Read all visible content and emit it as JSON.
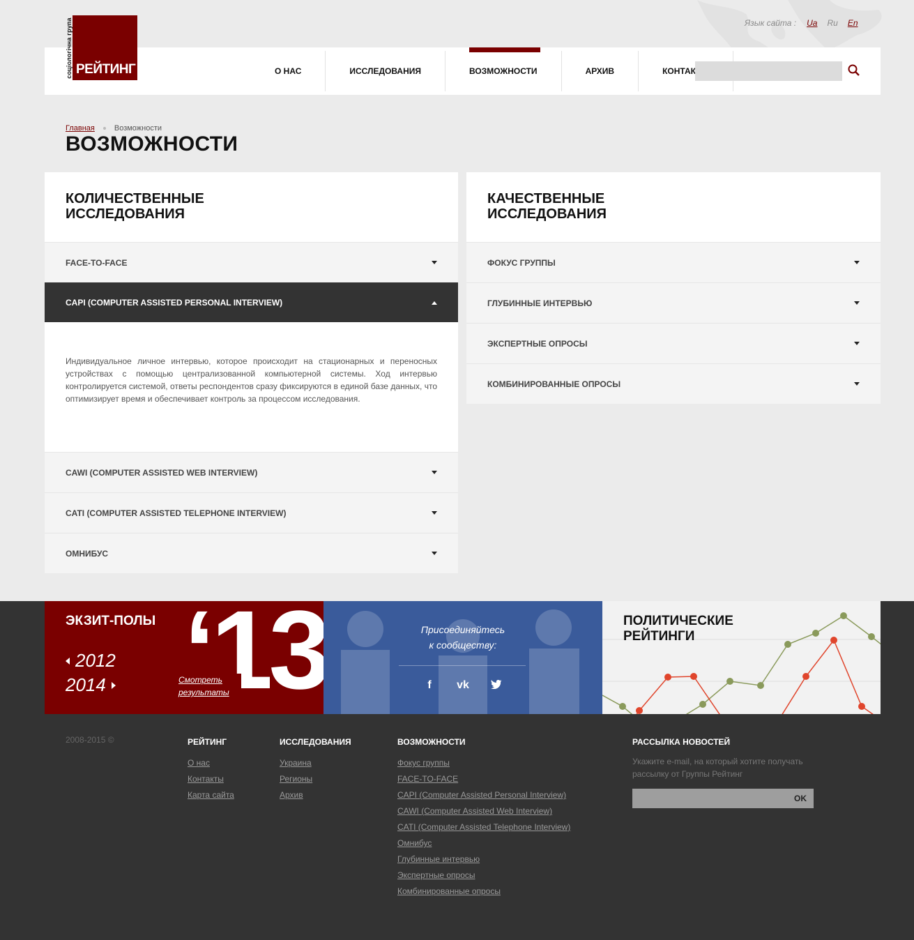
{
  "language": {
    "label": "Язык сайта :",
    "options": [
      "Ua",
      "Ru",
      "En"
    ]
  },
  "logo": {
    "vertical_text": "соціологічна група",
    "name": "РЕЙТИНГ"
  },
  "nav": {
    "items": [
      "О НАС",
      "ИССЛЕДОВАНИЯ",
      "ВОЗМОЖНОСТИ",
      "АРХИВ",
      "КОНТАКТЫ"
    ],
    "active": "ВОЗМОЖНОСТИ"
  },
  "search": {
    "placeholder": ""
  },
  "breadcrumb": {
    "home": "Главная",
    "current": "Возможности"
  },
  "page_title": "ВОЗМОЖНОСТИ",
  "quantitative": {
    "title_line1": "КОЛИЧЕСТВЕННЫЕ",
    "title_line2": "ИССЛЕДОВАНИЯ",
    "items": [
      "FACE-TO-FACE",
      "CAPI (COMPUTER ASSISTED PERSONAL INTERVIEW)",
      "CAWI (COMPUTER ASSISTED WEB INTERVIEW)",
      "CATI (COMPUTER ASSISTED TELEPHONE INTERVIEW)",
      "ОМНИБУС"
    ],
    "open_text": "Индивидуальное личное интервью, которое происходит на стационарных и переносных устройствах с помощью централизованной компьютерной системы. Ход интервью контролируется системой, ответы респондентов сразу фиксируются в единой базе данных, что оптимизирует время и обеспечивает контроль за процессом исследования."
  },
  "qualitative": {
    "title_line1": "КАЧЕСТВЕННЫЕ",
    "title_line2": "ИССЛЕДОВАНИЯ",
    "items": [
      "ФОКУС ГРУППЫ",
      "ГЛУБИННЫЕ ИНТЕРВЬЮ",
      "ЭКСПЕРТНЫЕ ОПРОСЫ",
      "КОМБИНИРОВАННЫЕ ОПРОСЫ"
    ]
  },
  "exit_polls": {
    "title": "ЭКЗИТ-ПОЛЫ",
    "year_prev": "2012",
    "year_next": "2014",
    "big_year": "‘13",
    "view_line1": "Смотреть",
    "view_line2": "результаты"
  },
  "social": {
    "line1": "Присоединяйтесь",
    "line2": "к сообществу:",
    "icons": [
      "facebook-icon",
      "vk-icon",
      "twitter-icon"
    ]
  },
  "ratings": {
    "title_line1": "ПОЛИТИЧЕСКИЕ",
    "title_line2": "РЕЙТИНГИ"
  },
  "footer": {
    "copyright": "2008-2015 ©",
    "col1": {
      "title": "РЕЙТИНГ",
      "links": [
        "О нас",
        "Контакты",
        "Карта сайта"
      ]
    },
    "col2": {
      "title": "ИССЛЕДОВАНИЯ",
      "links": [
        "Украина",
        "Регионы",
        "Архив"
      ]
    },
    "col3": {
      "title": "ВОЗМОЖНОСТИ",
      "links": [
        "Фокус группы",
        "FACE-TO-FACE",
        "CAPI (Computer Assisted Personal Interview)",
        "CAWI (Computer Assisted Web Interview)",
        "CATI (Computer Assisted Telephone Interview)",
        "Омнибус",
        "Глубинные интервью",
        "Экспертные опросы",
        "Комбинированные опросы"
      ]
    },
    "newsletter": {
      "title": "РАССЫЛКА НОВОСТЕЙ",
      "text": "Укажите e-mail, на который хотите получать рассылку от Группы Рейтинг",
      "button": "OK"
    }
  },
  "colors": {
    "brand": "#7a0000",
    "social_bg": "#3a5b9b",
    "dark": "#333333",
    "line_green": "#8a9a5b",
    "line_red": "#e0452c"
  }
}
